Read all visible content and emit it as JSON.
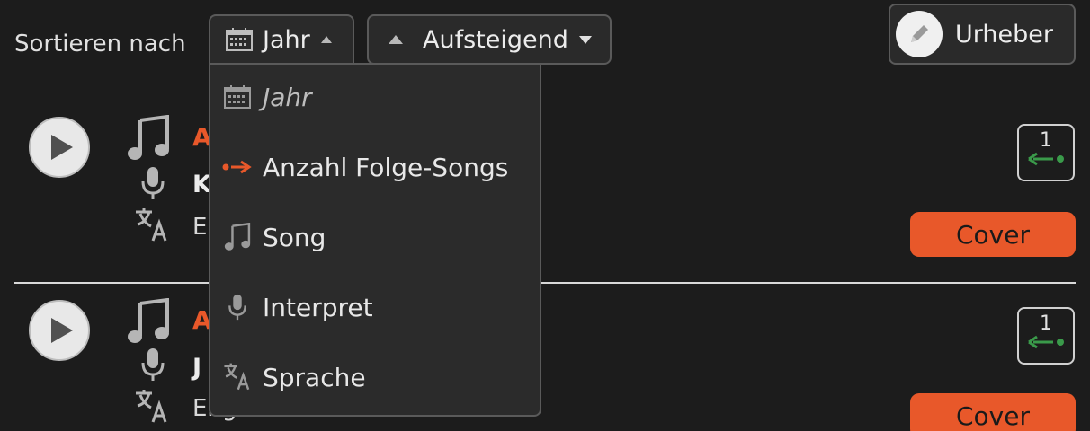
{
  "toolbar": {
    "sort_label": "Sortieren nach",
    "sort_field": "Jahr",
    "sort_direction": "Aufsteigend",
    "urheber_label": "Urheber"
  },
  "dropdown": {
    "items": [
      {
        "label": "Jahr",
        "icon": "calendar-icon",
        "selected": true
      },
      {
        "label": "Anzahl Folge-Songs",
        "icon": "arrow-right-icon",
        "selected": false
      },
      {
        "label": "Song",
        "icon": "music-note-icon",
        "selected": false
      },
      {
        "label": "Interpret",
        "icon": "microphone-icon",
        "selected": false
      },
      {
        "label": "Sprache",
        "icon": "translate-icon",
        "selected": false
      }
    ]
  },
  "songs": [
    {
      "title_partial": "A",
      "artist_partial": "K",
      "language_partial": "E",
      "follow_count": "1",
      "cover_label": "Cover"
    },
    {
      "title_partial": "A",
      "artist_partial": "J",
      "language_partial": "Englisch",
      "follow_count": "1",
      "cover_label": "Cover"
    }
  ],
  "colors": {
    "background": "#1c1c1c",
    "accent": "#e8582a",
    "arrow_green": "#3a9a4a",
    "menu_bg": "#2b2b2b"
  }
}
